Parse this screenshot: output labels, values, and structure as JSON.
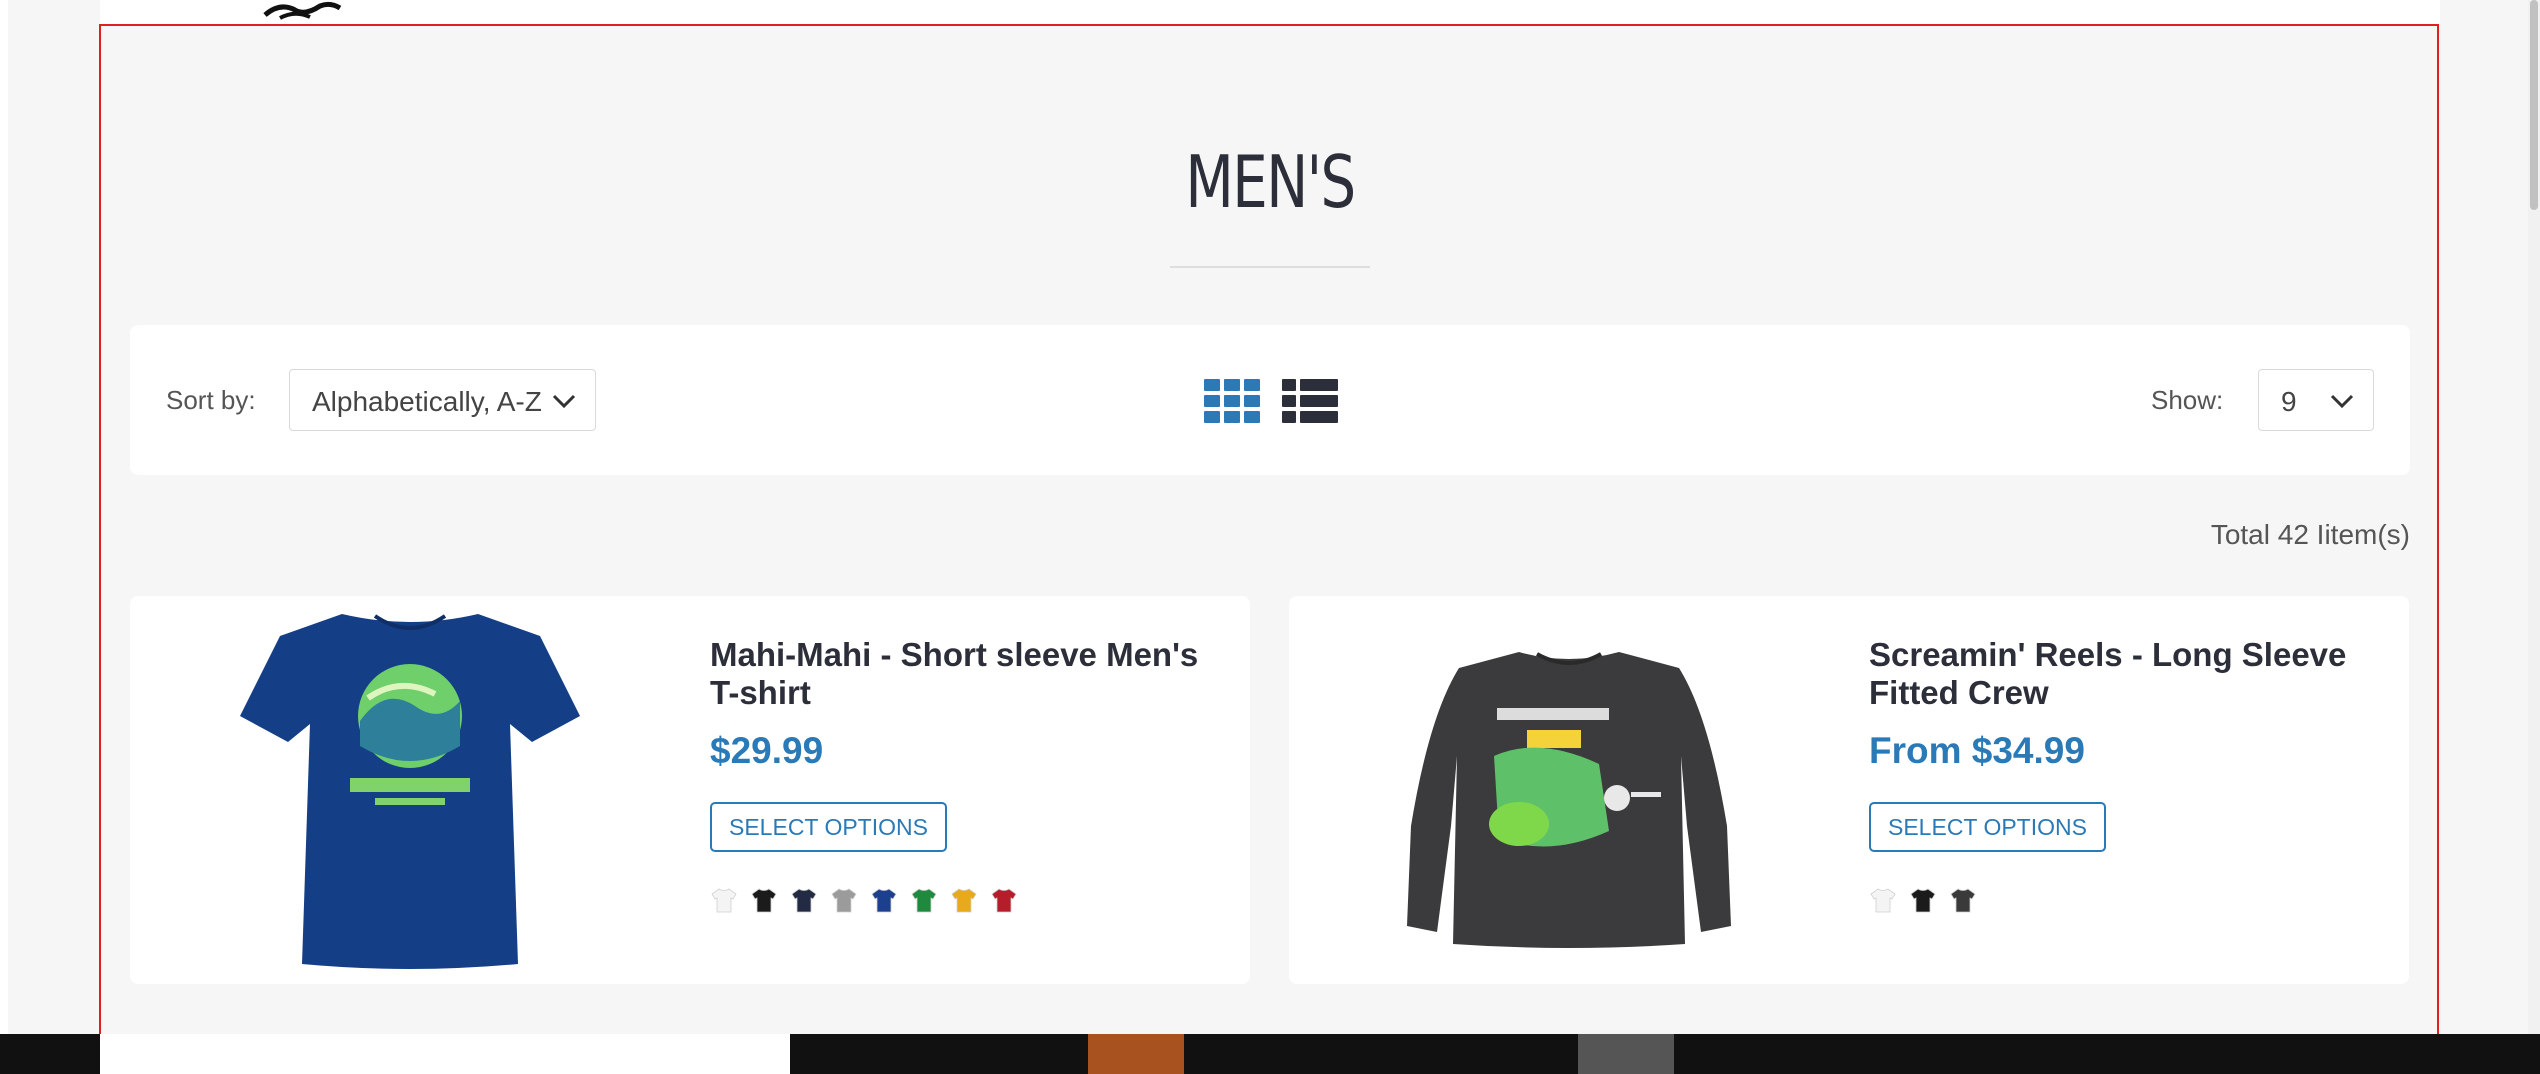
{
  "page": {
    "title": "MEN'S"
  },
  "toolbar": {
    "sort_label": "Sort by:",
    "sort_value": "Alphabetically, A-Z",
    "show_label": "Show:",
    "show_value": "9",
    "grid_icon": "grid-view-icon",
    "list_icon": "list-view-icon"
  },
  "total": "Total 42 Iitem(s)",
  "products": [
    {
      "name": "Mahi-Mahi - Short sleeve Men's T-shirt",
      "price": "$29.99",
      "button": "SELECT OPTIONS",
      "image": "navy-tshirt",
      "swatches": [
        "#f4f4f4",
        "#1b1b1b",
        "#232a44",
        "#9b9b9b",
        "#1c3f8e",
        "#1f8a3e",
        "#e8a91a",
        "#b51d2b"
      ]
    },
    {
      "name": "Screamin' Reels - Long Sleeve Fitted Crew",
      "price": "From $34.99",
      "button": "SELECT OPTIONS",
      "image": "charcoal-long-sleeve",
      "swatches": [
        "#f4f4f4",
        "#1b1b1b",
        "#3a3a3a"
      ]
    }
  ],
  "colors": {
    "accent": "#2a7ab8",
    "heading": "#2c2f3a",
    "page_bg": "#f6f6f6"
  }
}
